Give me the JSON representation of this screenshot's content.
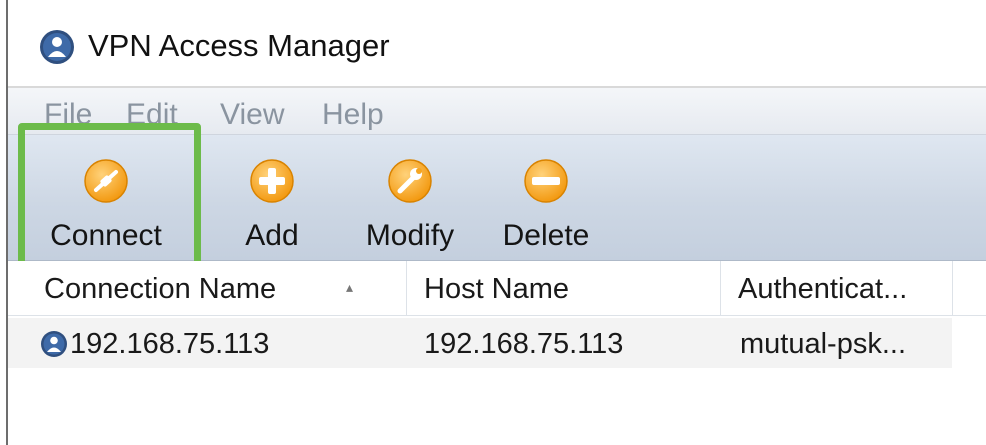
{
  "window": {
    "title": "VPN Access Manager",
    "icon": "globe-user-icon"
  },
  "menu": {
    "items": [
      "File",
      "Edit",
      "View",
      "Help"
    ]
  },
  "toolbar": {
    "buttons": [
      {
        "label": "Connect",
        "icon": "connect-plug-icon",
        "highlighted": true
      },
      {
        "label": "Add",
        "icon": "plus-icon"
      },
      {
        "label": "Modify",
        "icon": "wrench-icon"
      },
      {
        "label": "Delete",
        "icon": "minus-icon"
      }
    ]
  },
  "list": {
    "columns": [
      "Connection Name",
      "Host Name",
      "Authenticat..."
    ],
    "sort_column": "Connection Name",
    "rows": [
      {
        "connection_name": "192.168.75.113",
        "host_name": "192.168.75.113",
        "authentication": "mutual-psk...",
        "icon": "globe-user-icon"
      }
    ]
  },
  "colors": {
    "highlight": "#6cbb4a",
    "toolbar_icon": "#f5a623"
  }
}
